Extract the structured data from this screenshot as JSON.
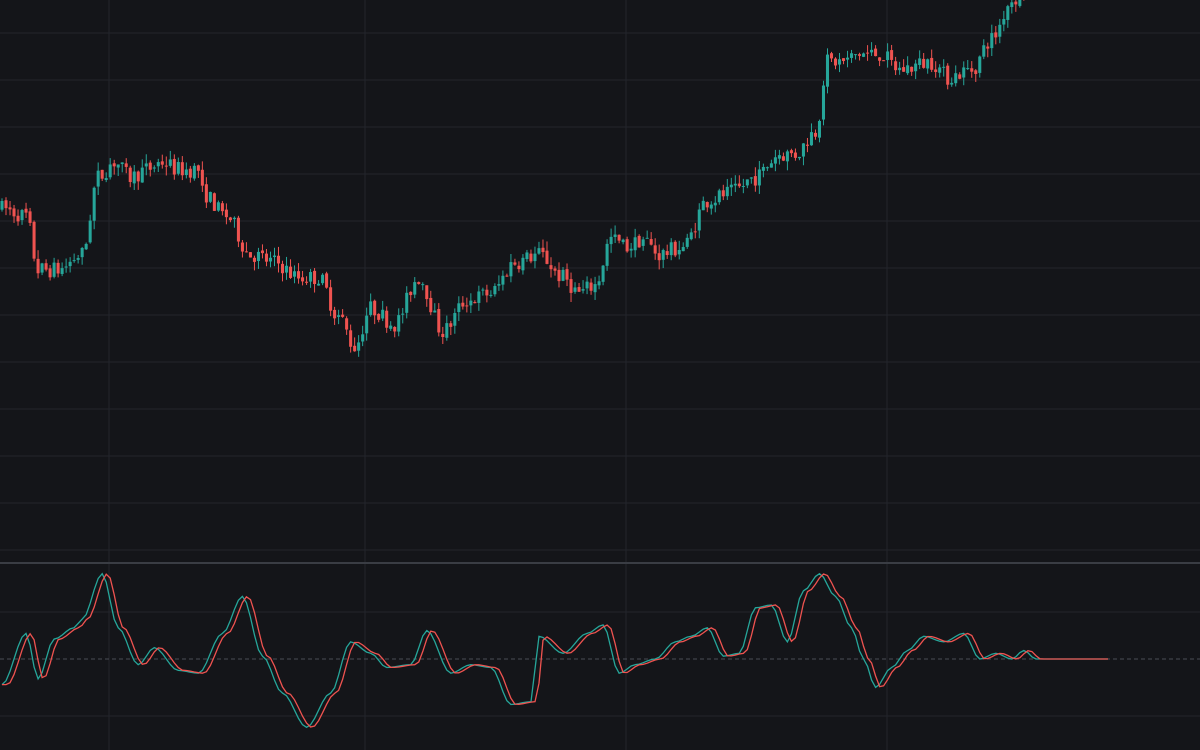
{
  "theme": {
    "background": "#141519",
    "grid": "#23252c",
    "separator": "#3a3d44",
    "zero_line": "#4a4d55",
    "up_color": "#26a69a",
    "down_color": "#ef5350",
    "fast_line": "#26a69a",
    "slow_line": "#ef5350"
  },
  "chart_data": [
    {
      "type": "candlestick",
      "name": "",
      "grid": true,
      "ylim": [
        52,
        124
      ],
      "anchors": [
        [
          0,
          97
        ],
        [
          6,
          96
        ],
        [
          9,
          89
        ],
        [
          14,
          89
        ],
        [
          20,
          91
        ],
        [
          24,
          101
        ],
        [
          28,
          103
        ],
        [
          32,
          101
        ],
        [
          36,
          102
        ],
        [
          40,
          103
        ],
        [
          44,
          102
        ],
        [
          49,
          102
        ],
        [
          50,
          99
        ],
        [
          56,
          96
        ],
        [
          62,
          91
        ],
        [
          68,
          90
        ],
        [
          74,
          88
        ],
        [
          79,
          88
        ],
        [
          84,
          83
        ],
        [
          88,
          79
        ],
        [
          92,
          84
        ],
        [
          98,
          82
        ],
        [
          104,
          88
        ],
        [
          110,
          81
        ],
        [
          116,
          85
        ],
        [
          122,
          86
        ],
        [
          128,
          90
        ],
        [
          134,
          91
        ],
        [
          140,
          88
        ],
        [
          144,
          86
        ],
        [
          148,
          87
        ],
        [
          152,
          93
        ],
        [
          156,
          92
        ],
        [
          160,
          93
        ],
        [
          164,
          91
        ],
        [
          170,
          92
        ],
        [
          176,
          98
        ],
        [
          182,
          99
        ],
        [
          188,
          101
        ],
        [
          194,
          104
        ],
        [
          198,
          104
        ],
        [
          203,
          107
        ],
        [
          206,
          116
        ],
        [
          210,
          116
        ],
        [
          214,
          117
        ],
        [
          219,
          117
        ],
        [
          224,
          115
        ],
        [
          232,
          116
        ],
        [
          236,
          114
        ],
        [
          242,
          115
        ],
        [
          247,
          119
        ],
        [
          252,
          124
        ],
        [
          256,
          126
        ],
        [
          260,
          131
        ],
        [
          266,
          134
        ],
        [
          270,
          128
        ],
        [
          274,
          131
        ],
        [
          276,
          136
        ]
      ],
      "up_color": "#26a69a",
      "down_color": "#ef5350"
    },
    {
      "type": "line",
      "name": "",
      "grid": true,
      "zero_line": true,
      "ylim": [
        -3.2,
        3.2
      ],
      "anchors": [
        [
          0,
          -0.9
        ],
        [
          6,
          0.9
        ],
        [
          9,
          -0.7
        ],
        [
          13,
          0.7
        ],
        [
          18,
          1.1
        ],
        [
          20,
          1.4
        ],
        [
          25,
          3.0
        ],
        [
          29,
          1.1
        ],
        [
          34,
          -0.2
        ],
        [
          38,
          0.4
        ],
        [
          44,
          -0.4
        ],
        [
          49,
          -0.5
        ],
        [
          55,
          0.9
        ],
        [
          60,
          2.2
        ],
        [
          65,
          0.1
        ],
        [
          70,
          -1.2
        ],
        [
          76,
          -2.4
        ],
        [
          82,
          -1.2
        ],
        [
          87,
          0.6
        ],
        [
          92,
          0.2
        ],
        [
          96,
          -0.3
        ],
        [
          102,
          -0.2
        ],
        [
          106,
          1.0
        ],
        [
          112,
          -0.5
        ],
        [
          117,
          -0.2
        ],
        [
          122,
          -0.3
        ],
        [
          127,
          -1.6
        ],
        [
          132,
          -1.5
        ],
        [
          134,
          0.8
        ],
        [
          140,
          0.2
        ],
        [
          146,
          0.9
        ],
        [
          150,
          1.2
        ],
        [
          154,
          -0.5
        ],
        [
          158,
          -0.2
        ],
        [
          163,
          0.0
        ],
        [
          168,
          0.6
        ],
        [
          172,
          0.8
        ],
        [
          176,
          1.1
        ],
        [
          180,
          0.1
        ],
        [
          184,
          0.2
        ],
        [
          188,
          1.8
        ],
        [
          192,
          1.9
        ],
        [
          196,
          0.6
        ],
        [
          200,
          2.4
        ],
        [
          204,
          3.0
        ],
        [
          208,
          2.2
        ],
        [
          212,
          1.1
        ],
        [
          215,
          0.0
        ],
        [
          218,
          -1.0
        ],
        [
          222,
          -0.3
        ],
        [
          226,
          0.3
        ],
        [
          230,
          0.8
        ],
        [
          235,
          0.6
        ],
        [
          240,
          0.9
        ],
        [
          244,
          0.0
        ],
        [
          248,
          0.2
        ],
        [
          252,
          0.0
        ],
        [
          255,
          0.3
        ],
        [
          258,
          0.0
        ]
      ],
      "series": [
        {
          "name": "",
          "lag": 0,
          "color": "#26a69a"
        },
        {
          "name": "",
          "lag": 1.3,
          "color": "#ef5350"
        }
      ]
    }
  ]
}
